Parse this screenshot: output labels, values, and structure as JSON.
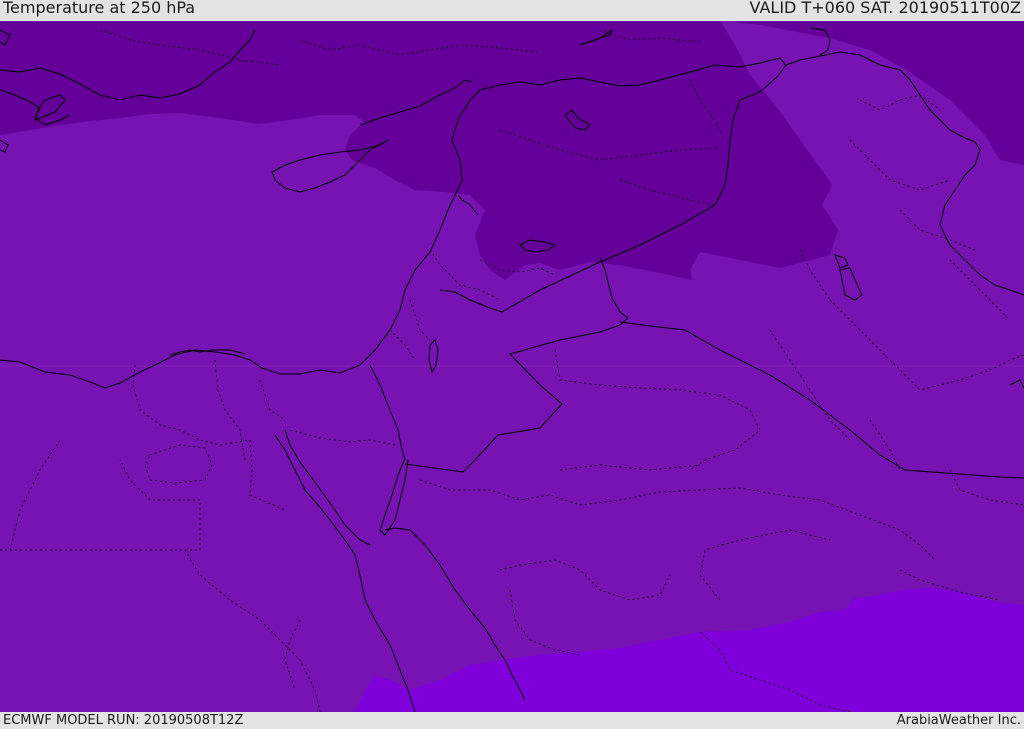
{
  "header": {
    "title": "Temperature at 250 hPa",
    "valid": "VALID T+060 SAT. 20190511T00Z"
  },
  "footer": {
    "model_run": "ECMWF MODEL RUN: 20190508T12Z",
    "brand": "ArabiaWeather Inc."
  },
  "colors": {
    "band_cold": "#640099",
    "band_mid": "#7712b3",
    "band_warm": "#7f00db",
    "coastline": "#000000",
    "border": "#000000",
    "chrome": "#e3e3e3"
  }
}
